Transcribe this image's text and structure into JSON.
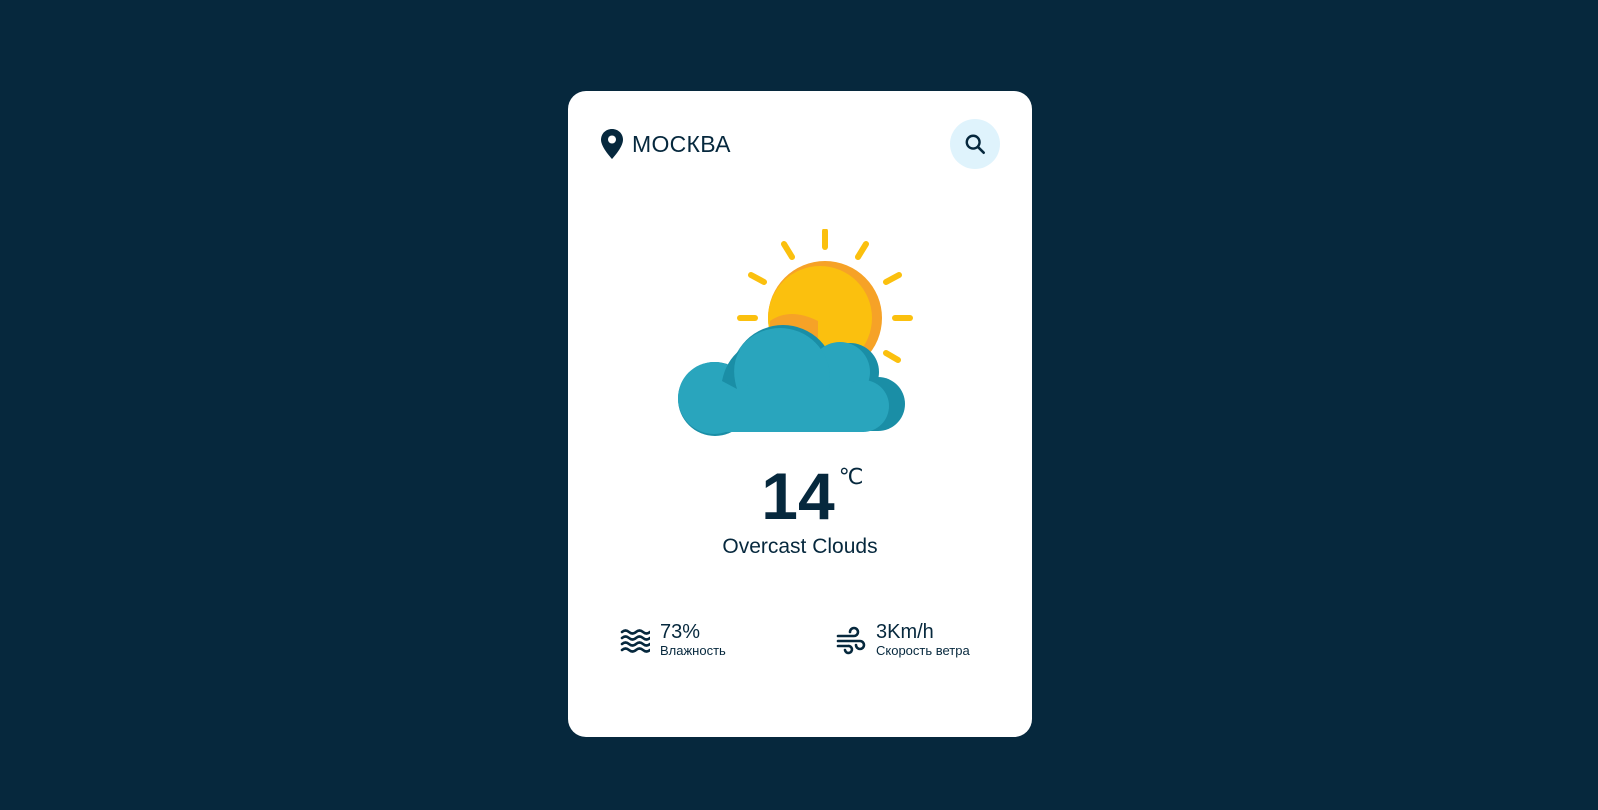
{
  "location": {
    "city": "МОСКВА",
    "icon": "map-pin-icon"
  },
  "search": {
    "icon": "search-icon"
  },
  "weather": {
    "icon": "partly-cloudy-icon",
    "temperature": "14",
    "unit": "℃",
    "description": "Overcast Clouds"
  },
  "details": {
    "humidity": {
      "value": "73%",
      "label": "Влажность",
      "icon": "waves-icon"
    },
    "wind": {
      "value": "3Km/h",
      "label": "Скорость ветра",
      "icon": "wind-icon"
    }
  },
  "colors": {
    "background": "#06283d",
    "card": "#ffffff",
    "text": "#06283d",
    "search_button": "#dff3fc",
    "sun": "#fbc00e",
    "sun_shade": "#f6a227",
    "cloud": "#29a5bd",
    "cloud_shade": "#1a8ea6"
  }
}
